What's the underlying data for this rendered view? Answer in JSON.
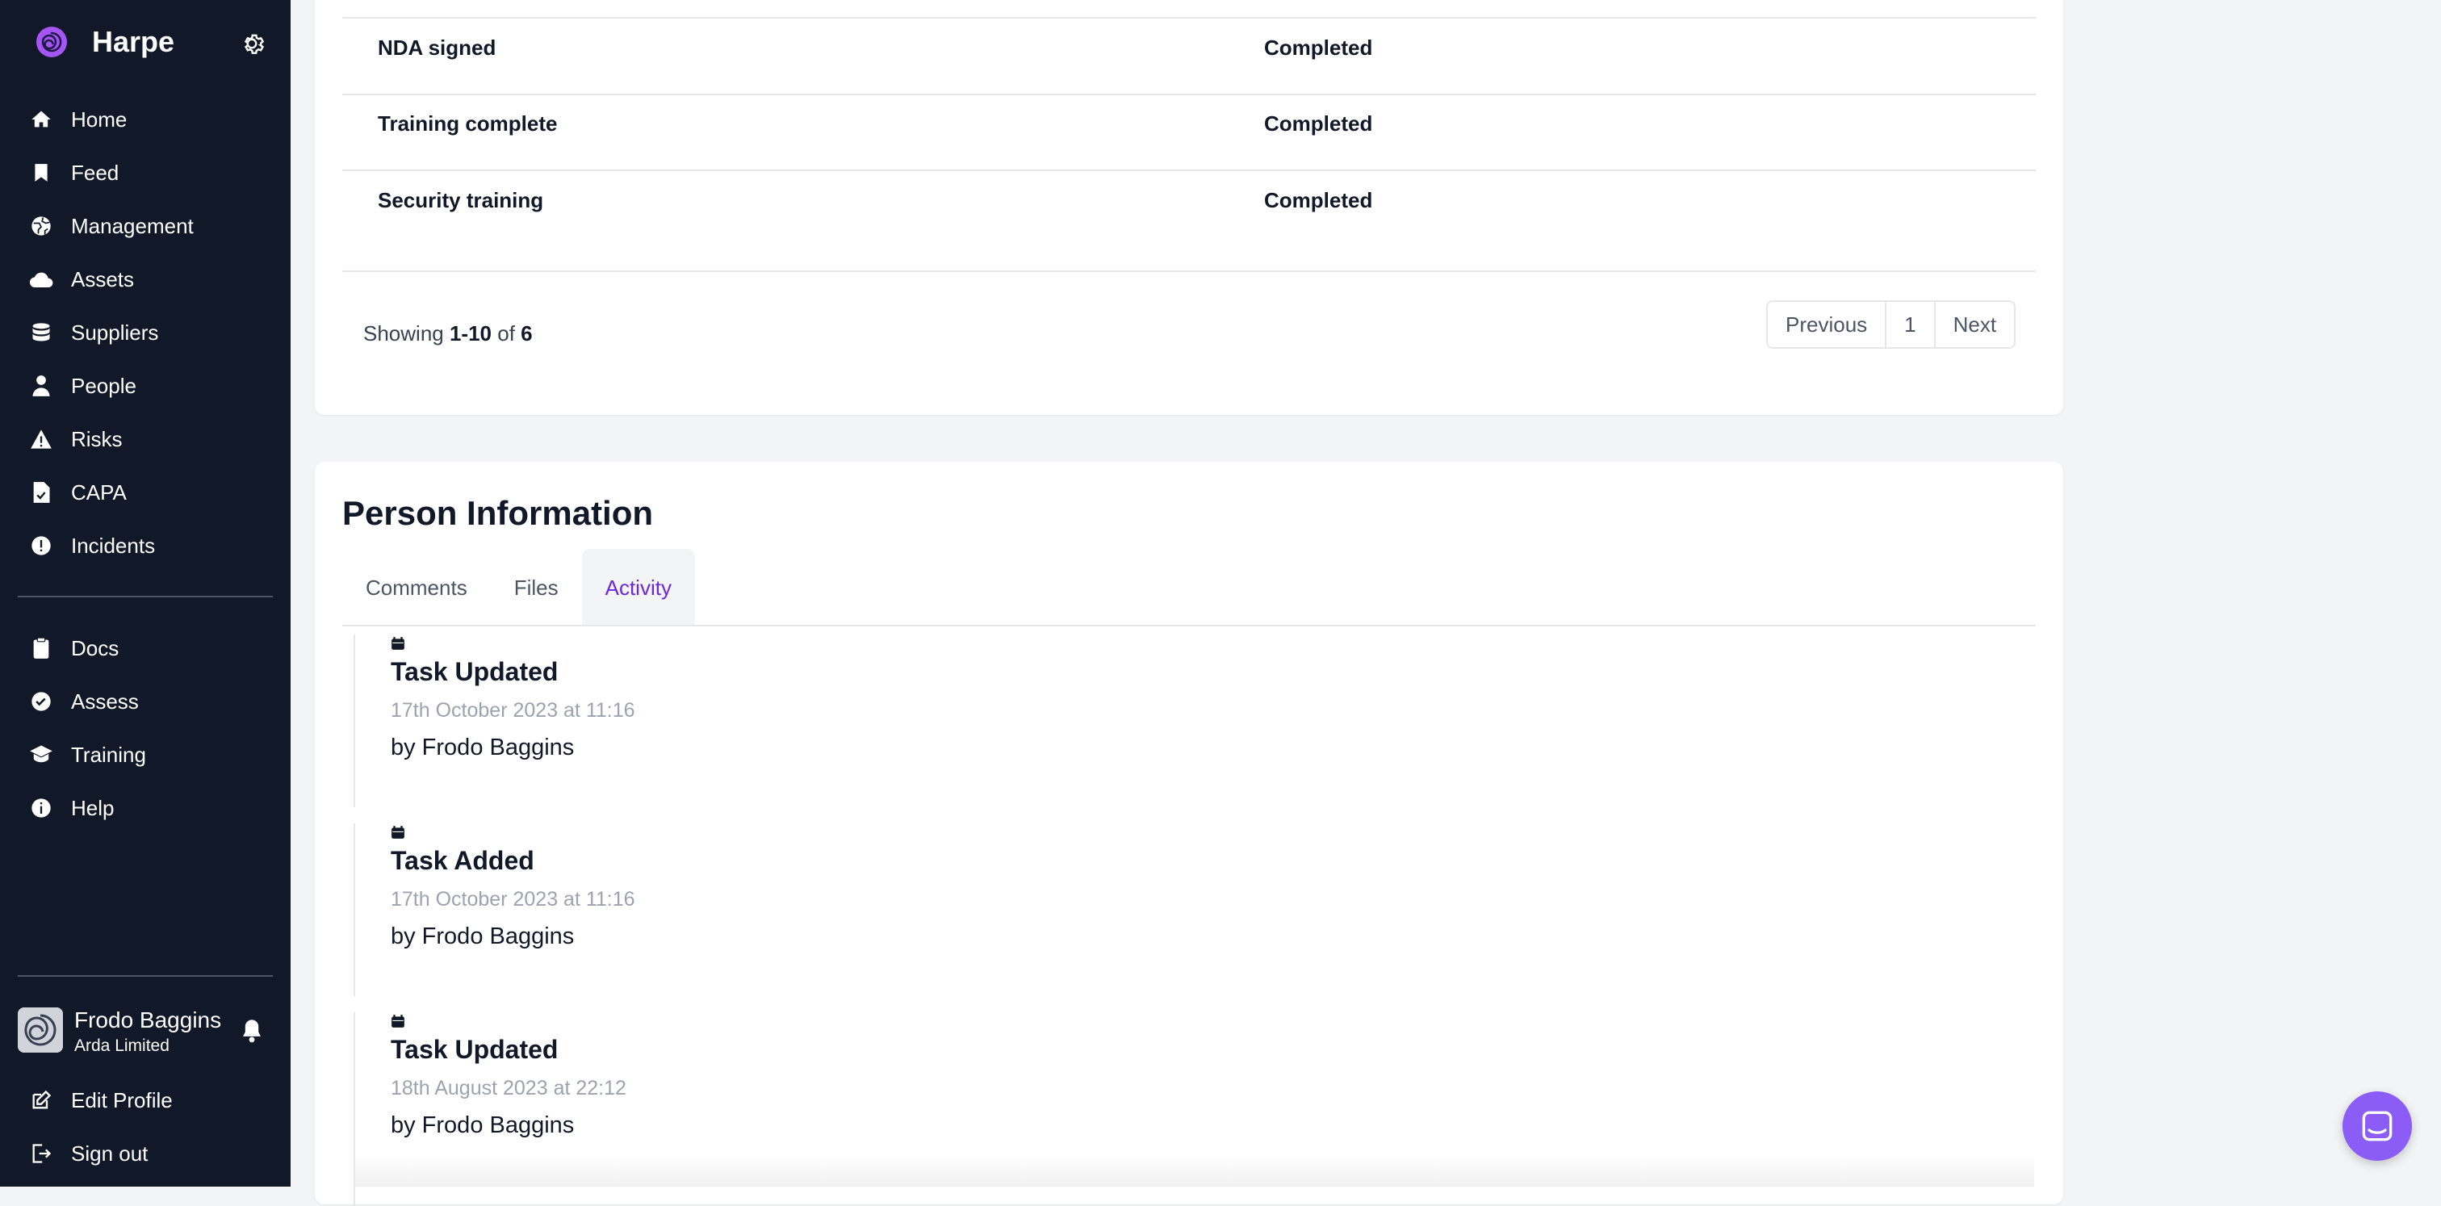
{
  "app": {
    "name": "Harpe"
  },
  "sidebar": {
    "primary": [
      {
        "label": "Home",
        "icon": "home-icon"
      },
      {
        "label": "Feed",
        "icon": "bookmark-icon"
      },
      {
        "label": "Management",
        "icon": "globe-icon"
      },
      {
        "label": "Assets",
        "icon": "cloud-icon"
      },
      {
        "label": "Suppliers",
        "icon": "database-icon"
      },
      {
        "label": "People",
        "icon": "user-icon"
      },
      {
        "label": "Risks",
        "icon": "warning-icon"
      },
      {
        "label": "CAPA",
        "icon": "document-check-icon"
      },
      {
        "label": "Incidents",
        "icon": "exclamation-circle-icon"
      }
    ],
    "secondary": [
      {
        "label": "Docs",
        "icon": "clipboard-icon"
      },
      {
        "label": "Assess",
        "icon": "check-badge-icon"
      },
      {
        "label": "Training",
        "icon": "graduation-cap-icon"
      },
      {
        "label": "Help",
        "icon": "info-icon"
      }
    ],
    "user": {
      "name": "Frodo Baggins",
      "org": "Arda Limited"
    },
    "footer": [
      {
        "label": "Edit Profile",
        "icon": "edit-icon"
      },
      {
        "label": "Sign out",
        "icon": "sign-out-icon"
      }
    ]
  },
  "training_table": {
    "rows": [
      {
        "name": "NDA signed",
        "status": "Completed"
      },
      {
        "name": "Training complete",
        "status": "Completed"
      },
      {
        "name": "Security training",
        "status": "Completed"
      }
    ],
    "showing_prefix": "Showing",
    "range": "1-10",
    "of_label": "of",
    "total": "6",
    "pagination": {
      "previous": "Previous",
      "page": "1",
      "next": "Next"
    }
  },
  "person_info": {
    "title": "Person Information",
    "tabs": [
      "Comments",
      "Files",
      "Activity"
    ],
    "active_tab": "Activity",
    "activities": [
      {
        "title": "Task Updated",
        "date": "17th October 2023 at 11:16",
        "by": "by Frodo Baggins"
      },
      {
        "title": "Task Added",
        "date": "17th October 2023 at 11:16",
        "by": "by Frodo Baggins"
      },
      {
        "title": "Task Updated",
        "date": "18th August 2023 at 22:12",
        "by": "by Frodo Baggins"
      }
    ]
  },
  "colors": {
    "sidebar_bg": "#111827",
    "accent": "#6d28d9",
    "chat_button": "#8b5cf6"
  }
}
